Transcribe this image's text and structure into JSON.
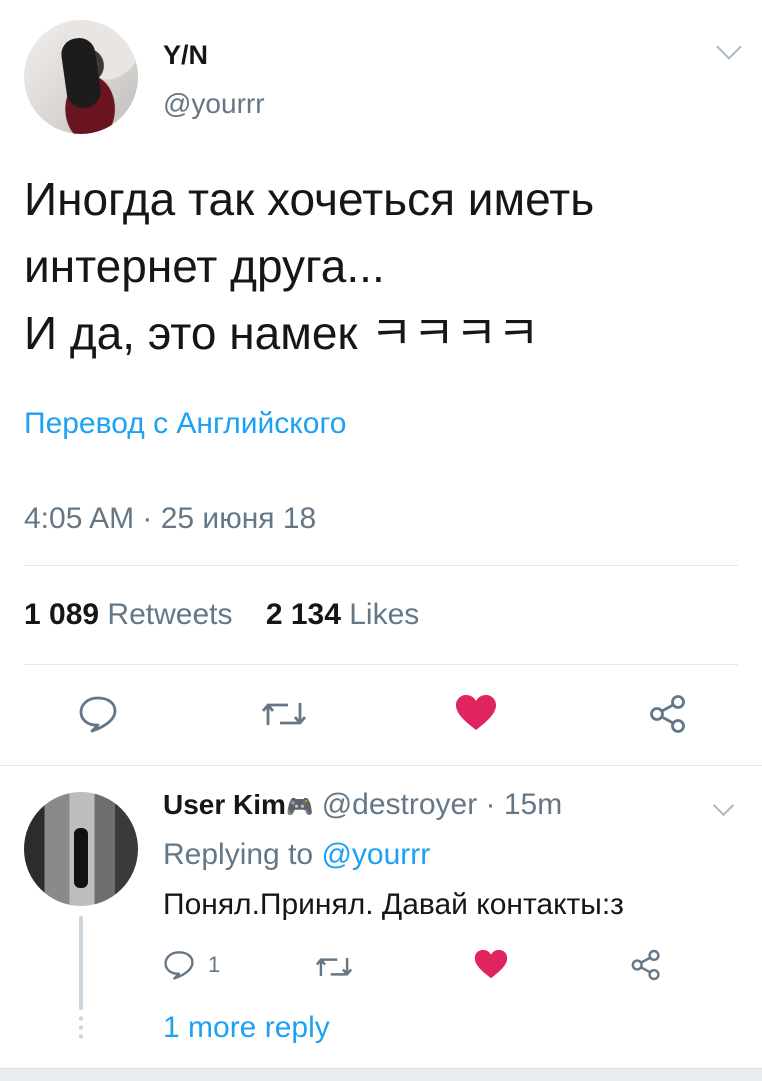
{
  "tweet": {
    "author_name": "Y/N",
    "author_handle": "@yourrr",
    "text_lines": [
      "Иногда так хочеться иметь",
      "интернет друга...",
      "И да, это намек ㅋㅋㅋㅋ"
    ],
    "translate_link": "Перевод с Английского",
    "timestamp": "4:05 AM · 25 июня 18",
    "retweets_count": "1 089",
    "retweets_label": "Retweets",
    "likes_count": "2 134",
    "likes_label": "Likes",
    "like_color": "#e0245e",
    "link_color": "#1da1f2"
  },
  "reply": {
    "author_name": "User Kim",
    "author_emoji": "🎮",
    "author_handle": "@destroyer",
    "time": "· 15m",
    "replying_prefix": "Replying to",
    "replying_handle": "@yourrr",
    "text": "Понял.Принял. Давай контакты:з",
    "reply_count": "1",
    "more_replies": "1 more reply"
  }
}
